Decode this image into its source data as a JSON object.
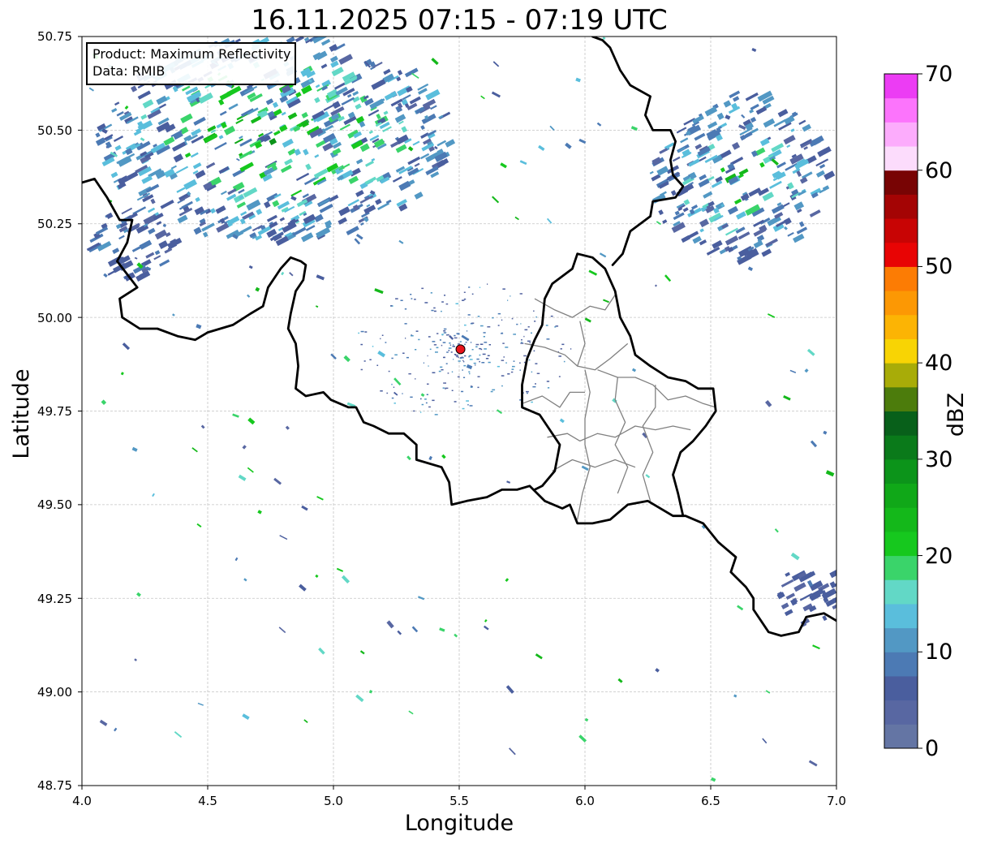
{
  "title": "16.11.2025 07:15 - 07:19 UTC",
  "info_box": {
    "product_line": "Product: Maximum Reflectivity",
    "data_line": "Data: RMIB"
  },
  "axes": {
    "xlabel": "Longitude",
    "ylabel": "Latitude",
    "xlim": [
      4.0,
      7.0
    ],
    "ylim": [
      48.75,
      50.75
    ],
    "xticks": [
      "4.0",
      "4.5",
      "5.0",
      "5.5",
      "6.0",
      "6.5",
      "7.0"
    ],
    "yticks": [
      "50.75",
      "50.50",
      "50.25",
      "50.00",
      "49.75",
      "49.50",
      "49.25",
      "49.00",
      "48.75"
    ],
    "grid": true
  },
  "colorbar": {
    "label": "dBZ",
    "range": [
      0,
      70
    ],
    "step": 2.5,
    "ticks": [
      "0",
      "10",
      "20",
      "30",
      "40",
      "50",
      "60",
      "70"
    ],
    "colors": [
      "#6475a4",
      "#5867a2",
      "#4a5e9e",
      "#4c7ab4",
      "#5298c4",
      "#5abedc",
      "#62d8c6",
      "#3ad46a",
      "#16c81e",
      "#14b81a",
      "#10a818",
      "#0c941a",
      "#0a7a1a",
      "#08601a",
      "#4c7c0c",
      "#a8ac08",
      "#f8d404",
      "#fcb404",
      "#fc9804",
      "#fc7c04",
      "#e80404",
      "#c80404",
      "#a40404",
      "#780404",
      "#fcdcfc",
      "#fcacfc",
      "#fc74fc",
      "#ec3cf4"
    ]
  },
  "radar_site": {
    "lon": 5.505,
    "lat": 49.915,
    "color": "#e8141a"
  },
  "chart_data": {
    "type": "map",
    "title": "16.11.2025 07:15 - 07:19 UTC",
    "xlabel": "Longitude",
    "ylabel": "Latitude",
    "xlim": [
      4.0,
      7.0
    ],
    "ylim": [
      48.75,
      50.75
    ],
    "colorbar_label": "dBZ",
    "colorbar_range": [
      0,
      70
    ],
    "radar_location": [
      5.505,
      49.915
    ],
    "echo_regions": [
      {
        "lon": [
          4.05,
          5.45
        ],
        "lat": [
          50.2,
          50.75
        ],
        "max_dbz": 30
      },
      {
        "lon": [
          4.0,
          4.35
        ],
        "lat": [
          50.1,
          50.3
        ],
        "max_dbz": 15
      },
      {
        "lon": [
          6.25,
          6.95
        ],
        "lat": [
          50.15,
          50.6
        ],
        "max_dbz": 25
      },
      {
        "lon": [
          6.75,
          7.0
        ],
        "lat": [
          49.18,
          49.35
        ],
        "max_dbz": 10
      }
    ],
    "borders": {
      "national": [
        [
          [
            4.0,
            50.36
          ],
          [
            4.05,
            50.37
          ],
          [
            4.1,
            50.32
          ],
          [
            4.15,
            50.26
          ],
          [
            4.2,
            50.26
          ],
          [
            4.18,
            50.2
          ],
          [
            4.14,
            50.15
          ],
          [
            4.22,
            50.08
          ],
          [
            4.15,
            50.05
          ],
          [
            4.16,
            50.0
          ],
          [
            4.23,
            49.97
          ],
          [
            4.3,
            49.97
          ],
          [
            4.38,
            49.95
          ],
          [
            4.45,
            49.94
          ],
          [
            4.5,
            49.96
          ],
          [
            4.55,
            49.97
          ],
          [
            4.6,
            49.98
          ],
          [
            4.67,
            50.01
          ],
          [
            4.72,
            50.03
          ],
          [
            4.74,
            50.08
          ],
          [
            4.79,
            50.13
          ],
          [
            4.83,
            50.16
          ],
          [
            4.87,
            50.15
          ],
          [
            4.89,
            50.14
          ],
          [
            4.88,
            50.1
          ],
          [
            4.85,
            50.07
          ],
          [
            4.83,
            50.01
          ],
          [
            4.82,
            49.97
          ],
          [
            4.85,
            49.93
          ],
          [
            4.86,
            49.87
          ],
          [
            4.85,
            49.81
          ],
          [
            4.89,
            49.79
          ],
          [
            4.96,
            49.8
          ],
          [
            4.99,
            49.78
          ],
          [
            5.06,
            49.76
          ],
          [
            5.09,
            49.76
          ],
          [
            5.12,
            49.72
          ],
          [
            5.16,
            49.71
          ],
          [
            5.22,
            49.69
          ],
          [
            5.28,
            49.69
          ],
          [
            5.33,
            49.66
          ],
          [
            5.33,
            49.62
          ],
          [
            5.43,
            49.6
          ],
          [
            5.46,
            49.56
          ],
          [
            5.47,
            49.5
          ],
          [
            5.53,
            49.51
          ],
          [
            5.61,
            49.52
          ],
          [
            5.67,
            49.54
          ],
          [
            5.73,
            49.54
          ],
          [
            5.78,
            49.55
          ],
          [
            5.84,
            49.51
          ],
          [
            5.91,
            49.49
          ],
          [
            5.94,
            49.5
          ],
          [
            5.97,
            49.45
          ],
          [
            6.03,
            49.45
          ],
          [
            6.1,
            49.46
          ],
          [
            6.17,
            49.5
          ],
          [
            6.25,
            49.51
          ],
          [
            6.35,
            49.47
          ],
          [
            6.4,
            49.47
          ],
          [
            6.47,
            49.45
          ],
          [
            6.53,
            49.4
          ],
          [
            6.6,
            49.36
          ],
          [
            6.58,
            49.32
          ],
          [
            6.64,
            49.28
          ],
          [
            6.67,
            49.25
          ],
          [
            6.67,
            49.22
          ],
          [
            6.73,
            49.16
          ],
          [
            6.78,
            49.15
          ],
          [
            6.85,
            49.16
          ],
          [
            6.88,
            49.2
          ],
          [
            6.95,
            49.21
          ],
          [
            7.0,
            49.19
          ]
        ],
        [
          [
            6.39,
            49.47
          ],
          [
            6.37,
            49.53
          ],
          [
            6.35,
            49.58
          ],
          [
            6.38,
            49.64
          ],
          [
            6.43,
            49.67
          ],
          [
            6.48,
            49.71
          ],
          [
            6.52,
            49.75
          ],
          [
            6.51,
            49.81
          ],
          [
            6.45,
            49.81
          ],
          [
            6.4,
            49.83
          ],
          [
            6.33,
            49.84
          ],
          [
            6.26,
            49.87
          ],
          [
            6.2,
            49.9
          ],
          [
            6.18,
            49.95
          ],
          [
            6.14,
            50.0
          ],
          [
            6.12,
            50.07
          ],
          [
            6.08,
            50.13
          ],
          [
            6.03,
            50.16
          ],
          [
            5.97,
            50.17
          ],
          [
            5.95,
            50.13
          ],
          [
            5.87,
            50.09
          ],
          [
            5.84,
            50.05
          ],
          [
            5.83,
            49.98
          ],
          [
            5.8,
            49.94
          ],
          [
            5.77,
            49.89
          ],
          [
            5.75,
            49.82
          ],
          [
            5.75,
            49.76
          ],
          [
            5.82,
            49.74
          ],
          [
            5.9,
            49.66
          ],
          [
            5.88,
            49.59
          ],
          [
            5.83,
            49.55
          ],
          [
            5.8,
            49.54
          ]
        ],
        [
          [
            6.11,
            50.14
          ],
          [
            6.15,
            50.17
          ],
          [
            6.18,
            50.23
          ],
          [
            6.26,
            50.27
          ],
          [
            6.27,
            50.31
          ],
          [
            6.36,
            50.32
          ],
          [
            6.39,
            50.35
          ],
          [
            6.35,
            50.38
          ],
          [
            6.34,
            50.42
          ],
          [
            6.36,
            50.47
          ],
          [
            6.34,
            50.5
          ],
          [
            6.27,
            50.5
          ],
          [
            6.24,
            50.54
          ],
          [
            6.26,
            50.59
          ],
          [
            6.18,
            50.62
          ],
          [
            6.14,
            50.66
          ],
          [
            6.1,
            50.72
          ],
          [
            6.07,
            50.74
          ],
          [
            6.03,
            50.75
          ]
        ]
      ],
      "regional": [
        [
          [
            5.85,
            49.68
          ],
          [
            5.93,
            49.69
          ],
          [
            5.98,
            49.67
          ],
          [
            6.05,
            49.69
          ],
          [
            6.12,
            49.68
          ],
          [
            6.2,
            49.71
          ],
          [
            6.28,
            49.7
          ],
          [
            6.35,
            49.71
          ],
          [
            6.42,
            49.7
          ]
        ],
        [
          [
            6.0,
            49.86
          ],
          [
            6.02,
            49.8
          ],
          [
            6.0,
            49.73
          ],
          [
            6.0,
            49.66
          ],
          [
            6.02,
            49.6
          ],
          [
            5.99,
            49.53
          ],
          [
            5.97,
            49.46
          ]
        ],
        [
          [
            6.05,
            49.86
          ],
          [
            6.13,
            49.84
          ],
          [
            6.2,
            49.84
          ],
          [
            6.27,
            49.82
          ],
          [
            6.33,
            49.78
          ],
          [
            6.4,
            49.79
          ],
          [
            6.47,
            49.77
          ],
          [
            6.52,
            49.76
          ]
        ],
        [
          [
            5.8,
            50.05
          ],
          [
            5.88,
            50.02
          ],
          [
            5.95,
            50.0
          ],
          [
            6.02,
            50.03
          ],
          [
            6.08,
            50.02
          ],
          [
            6.12,
            50.06
          ]
        ],
        [
          [
            5.76,
            49.93
          ],
          [
            5.84,
            49.92
          ],
          [
            5.92,
            49.9
          ],
          [
            5.97,
            49.87
          ],
          [
            6.04,
            49.86
          ],
          [
            6.1,
            49.89
          ],
          [
            6.17,
            49.93
          ]
        ],
        [
          [
            5.98,
            49.99
          ],
          [
            6.0,
            49.93
          ],
          [
            5.97,
            49.87
          ]
        ],
        [
          [
            6.13,
            49.84
          ],
          [
            6.12,
            49.78
          ],
          [
            6.16,
            49.72
          ],
          [
            6.12,
            49.66
          ],
          [
            6.17,
            49.6
          ],
          [
            6.13,
            49.53
          ]
        ],
        [
          [
            6.28,
            49.82
          ],
          [
            6.28,
            49.76
          ],
          [
            6.23,
            49.71
          ],
          [
            6.27,
            49.64
          ],
          [
            6.23,
            49.58
          ],
          [
            6.26,
            49.51
          ]
        ],
        [
          [
            5.87,
            49.59
          ],
          [
            5.95,
            49.62
          ],
          [
            6.04,
            49.6
          ],
          [
            6.12,
            49.62
          ],
          [
            6.2,
            49.6
          ]
        ],
        [
          [
            5.75,
            49.77
          ],
          [
            5.83,
            49.79
          ],
          [
            5.9,
            49.76
          ],
          [
            5.94,
            49.8
          ],
          [
            6.0,
            49.8
          ]
        ]
      ]
    }
  }
}
